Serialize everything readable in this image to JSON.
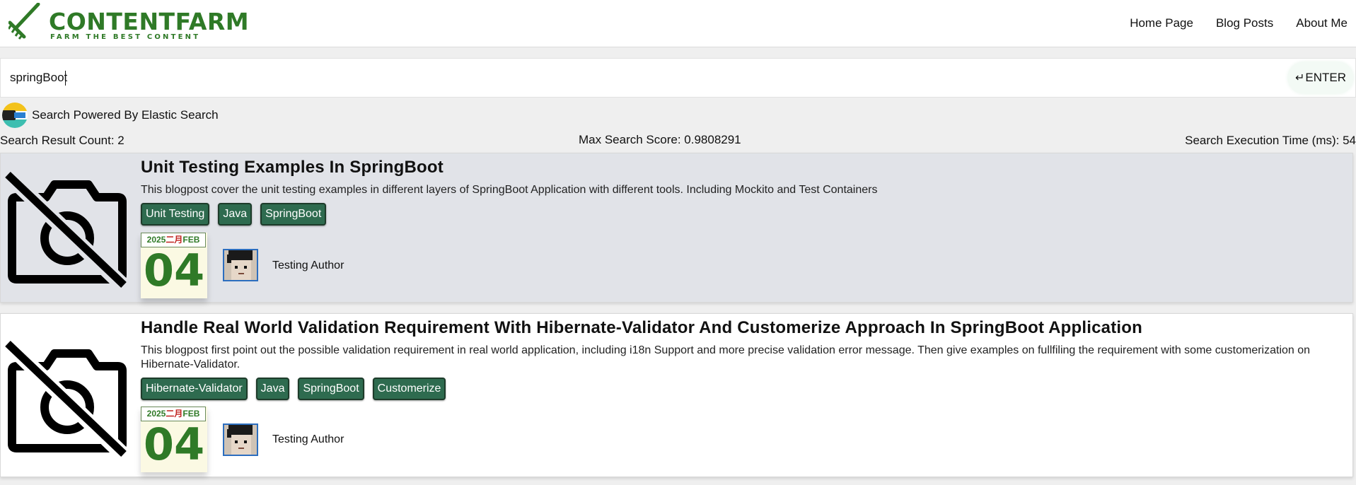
{
  "header": {
    "brand": "CONTENTFARM",
    "slogan": "FARM THE BEST CONTENT",
    "nav": [
      "Home Page",
      "Blog Posts",
      "About Me"
    ]
  },
  "search": {
    "value": "springBoot",
    "enter_arrow": "↵",
    "enter_label": "ENTER",
    "powered_by": "Search Powered By Elastic Search"
  },
  "stats": {
    "count": "Search Result Count: 2",
    "max_score": "Max Search Score: 0.9808291",
    "exec_time": "Search Execution Time (ms): 54"
  },
  "results": [
    {
      "title": "Unit Testing Examples In SpringBoot",
      "description": "This blogpost cover the unit testing examples in different layers of SpringBoot Application with different tools. Including Mockito and Test Containers",
      "tags": [
        "Unit Testing",
        "Java",
        "SpringBoot"
      ],
      "date": {
        "year": "2025",
        "month_cn": "二月",
        "month_en": "FEB",
        "day": "04"
      },
      "author": "Testing Author"
    },
    {
      "title": "Handle Real World Validation Requirement With Hibernate-Validator And Customerize Approach In SpringBoot Application",
      "description": "This blogpost first point out the possible validation requirement in real world application, including i18n Support and more precise validation error message. Then give examples on fullfiling the requirement with some customerization on Hibernate-Validator.",
      "tags": [
        "Hibernate-Validator",
        "Java",
        "SpringBoot",
        "Customerize"
      ],
      "date": {
        "year": "2025",
        "month_cn": "二月",
        "month_en": "FEB",
        "day": "04"
      },
      "author": "Testing Author"
    }
  ],
  "colors": {
    "brand_green": "#2f7a27",
    "tag_bg": "#2e6b4f",
    "highlight_row": "#e1e3e8"
  },
  "icons": {
    "logo": "rake-icon",
    "thumbnail": "no-image-camera-icon",
    "search_provider": "elastic-search-icon"
  }
}
